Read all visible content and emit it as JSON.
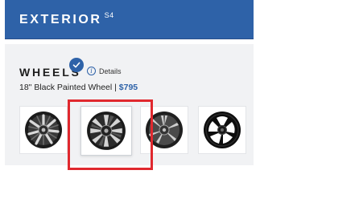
{
  "header": {
    "title": "EXTERIOR",
    "superscript": "S4",
    "background_color": "#2e62a8"
  },
  "wheels_section": {
    "title": "WHEELS",
    "details_icon": "info-icon",
    "details_label": "Details",
    "selected_name": "18\" Black Painted Wheel",
    "separator": " | ",
    "selected_price": "$795",
    "price_color": "#2e62a8"
  },
  "wheel_options": [
    {
      "icon": "wheel-multispoke-machined-icon",
      "selected": false
    },
    {
      "icon": "wheel-black-painted-icon",
      "selected": true
    },
    {
      "icon": "wheel-split-spoke-silver-icon",
      "selected": false
    },
    {
      "icon": "wheel-gloss-black-five-spoke-icon",
      "selected": false
    }
  ],
  "selection_check_icon": "checkmark-icon",
  "highlight_color": "#e0282e"
}
